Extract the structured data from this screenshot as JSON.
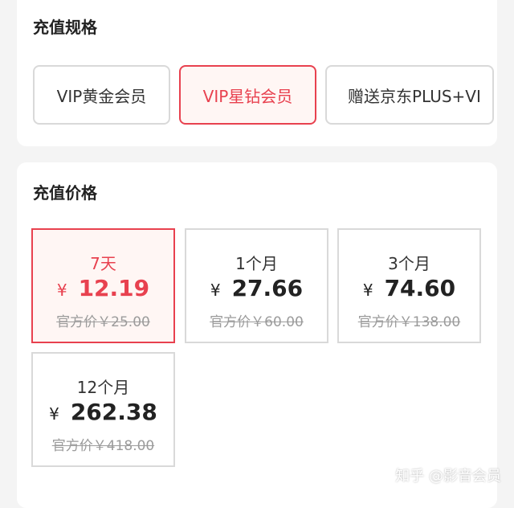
{
  "spec": {
    "title": "充值规格",
    "options": [
      {
        "label": "VIP黄金会员",
        "selected": false
      },
      {
        "label": "VIP星钻会员",
        "selected": true
      },
      {
        "label": "赠送京东PLUS+VI",
        "selected": false
      }
    ]
  },
  "price": {
    "title": "充值价格",
    "currency": "¥",
    "original_prefix": "官方价",
    "options": [
      {
        "duration": "7天",
        "price": "12.19",
        "original": "官方价￥25.00",
        "selected": true
      },
      {
        "duration": "1个月",
        "price": "27.66",
        "original": "官方价￥60.00",
        "selected": false
      },
      {
        "duration": "3个月",
        "price": "74.60",
        "original": "官方价￥138.00",
        "selected": false
      },
      {
        "duration": "12个月",
        "price": "262.38",
        "original": "官方价￥418.00",
        "selected": false
      }
    ]
  },
  "colors": {
    "accent": "#e8414f",
    "selected_bg": "#fff6f4",
    "border": "#d9d9d9"
  },
  "watermark": "知乎 @影音会员"
}
